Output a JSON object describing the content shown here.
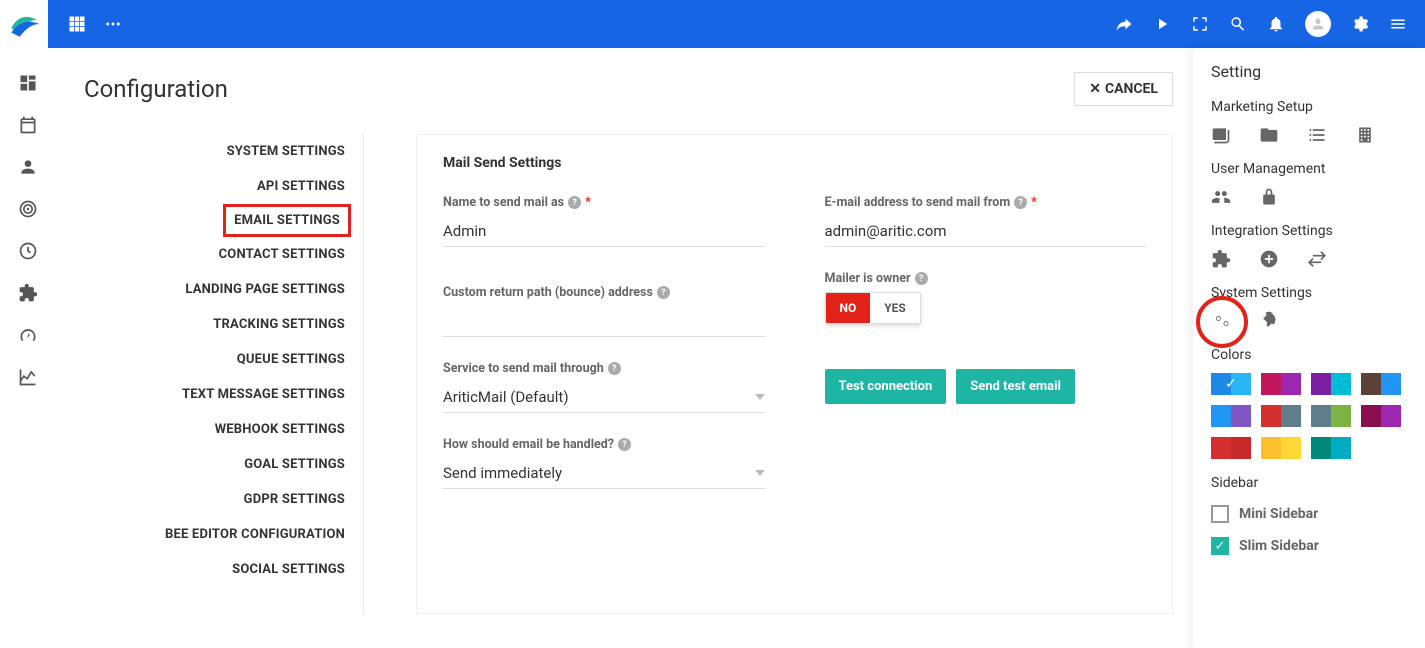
{
  "header": {
    "page_title": "Configuration",
    "cancel_label": "CANCEL"
  },
  "settings_nav": {
    "items": [
      {
        "label": "SYSTEM SETTINGS"
      },
      {
        "label": "API SETTINGS"
      },
      {
        "label": "EMAIL SETTINGS",
        "active": true
      },
      {
        "label": "CONTACT SETTINGS"
      },
      {
        "label": "LANDING PAGE SETTINGS"
      },
      {
        "label": "TRACKING SETTINGS"
      },
      {
        "label": "QUEUE SETTINGS"
      },
      {
        "label": "TEXT MESSAGE SETTINGS"
      },
      {
        "label": "WEBHOOK SETTINGS"
      },
      {
        "label": "GOAL SETTINGS"
      },
      {
        "label": "GDPR SETTINGS"
      },
      {
        "label": "BEE EDITOR CONFIGURATION"
      },
      {
        "label": "SOCIAL SETTINGS"
      }
    ]
  },
  "panel": {
    "heading": "Mail Send Settings",
    "fields": {
      "name_to_send": {
        "label": "Name to send mail as",
        "value": "Admin",
        "required": true
      },
      "email_from": {
        "label": "E-mail address to send mail from",
        "value": "admin@aritic.com",
        "required": true
      },
      "bounce_path": {
        "label": "Custom return path (bounce) address"
      },
      "mailer_owner": {
        "label": "Mailer is owner",
        "no": "NO",
        "yes": "YES",
        "selected": "NO"
      },
      "service": {
        "label": "Service to send mail through",
        "value": "AriticMail (Default)"
      },
      "test_connection": "Test connection",
      "send_test_email": "Send test email",
      "handle": {
        "label": "How should email be handled?",
        "value": "Send immediately"
      }
    }
  },
  "drawer": {
    "heading": "Setting",
    "sections": {
      "marketing_setup": "Marketing Setup",
      "user_management": "User Management",
      "integration_settings": "Integration Settings",
      "system_settings": "System Settings",
      "colors": "Colors",
      "sidebar": "Sidebar"
    },
    "color_swatches": [
      [
        "#1e88e5",
        "#29b6f6",
        true
      ],
      [
        "#c2185b",
        "#9c27b0"
      ],
      [
        "#7b1fa2",
        "#00bcd4"
      ],
      [
        "#5d4037",
        "#2196f3"
      ],
      [
        "#2196f3",
        "#7e57c2"
      ],
      [
        "#d32f2f",
        "#607d8b"
      ],
      [
        "#607d8b",
        "#7cb342"
      ],
      [
        "#880e4f",
        "#9c27b0"
      ],
      [
        "#d32f2f",
        "#c62828"
      ],
      [
        "#fbc02d",
        "#fdd835"
      ],
      [
        "#00897b",
        "#00acc1"
      ]
    ],
    "checkboxes": {
      "mini_sidebar": {
        "label": "Mini Sidebar",
        "checked": false
      },
      "slim_sidebar": {
        "label": "Slim Sidebar",
        "checked": true
      }
    }
  }
}
